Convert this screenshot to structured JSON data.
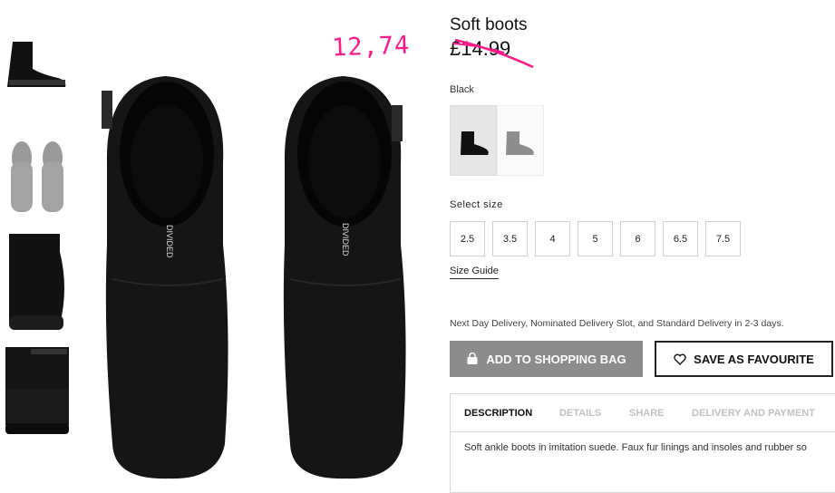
{
  "product": {
    "title": "Soft boots",
    "old_price": "£14.99",
    "handwritten_price": "12,74",
    "color_label": "Black",
    "size_label": "Select size",
    "sizes": [
      "2.5",
      "3.5",
      "4",
      "5",
      "6",
      "6.5",
      "7.5"
    ],
    "size_guide": "Size Guide",
    "delivery_note": "Next Day Delivery, Nominated Delivery Slot, and Standard Delivery in 2-3 days.",
    "add_to_bag": "ADD TO SHOPPING BAG",
    "save_favourite": "SAVE AS FAVOURITE"
  },
  "tabs": [
    "DESCRIPTION",
    "DETAILS",
    "SHARE",
    "DELIVERY AND PAYMENT"
  ],
  "description": "Soft ankle boots in imitation suede. Faux fur linings and insoles and rubber so",
  "boot_brand_text": "DIVIDED",
  "colors": {
    "accent_pink": "#ff1a8c",
    "button_grey": "#8c8c8c",
    "swatch_selected": "#e6e6e6"
  },
  "icons": [
    "shopping-bag-icon",
    "heart-icon"
  ]
}
